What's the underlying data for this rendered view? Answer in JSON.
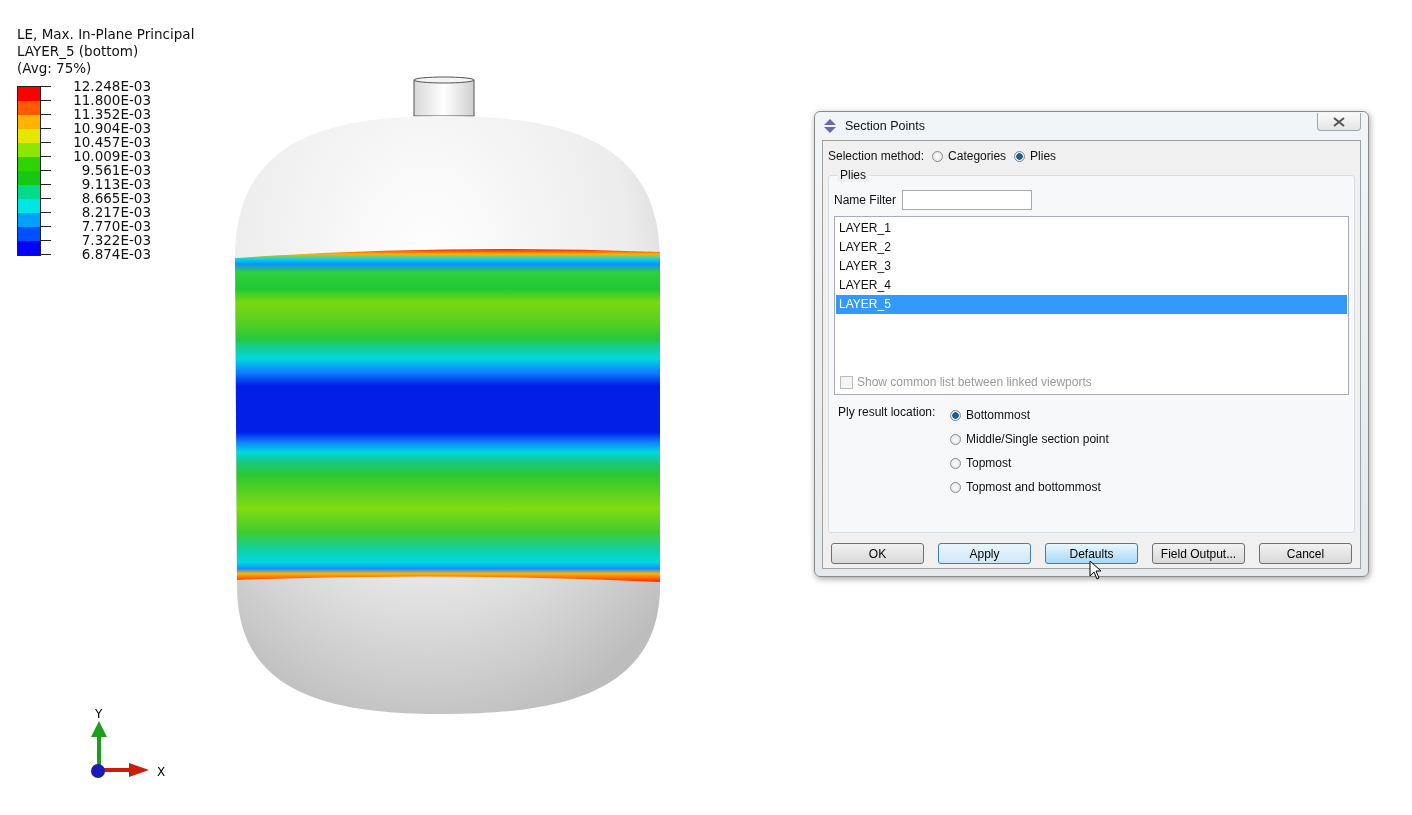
{
  "legend": {
    "title_lines": [
      "LE, Max. In-Plane Principal",
      "LAYER_5 (bottom)",
      "(Avg: 75%)"
    ],
    "bands": [
      {
        "color": "#ff0000"
      },
      {
        "color": "#ff5a00"
      },
      {
        "color": "#ffb400"
      },
      {
        "color": "#e6e600"
      },
      {
        "color": "#8ce600"
      },
      {
        "color": "#2ed400"
      },
      {
        "color": "#14c814"
      },
      {
        "color": "#00dc8c"
      },
      {
        "color": "#00e6e6"
      },
      {
        "color": "#00a0ff"
      },
      {
        "color": "#0050ff"
      },
      {
        "color": "#0000ff"
      }
    ],
    "ticks": [
      "12.248E-03",
      "11.800E-03",
      "11.352E-03",
      "10.904E-03",
      "10.457E-03",
      "10.009E-03",
      "9.561E-03",
      "9.113E-03",
      "8.665E-03",
      "8.217E-03",
      "7.770E-03",
      "7.322E-03",
      "6.874E-03"
    ]
  },
  "axes": {
    "y_label": "Y",
    "x_label": "X"
  },
  "dialog": {
    "title": "Section Points",
    "selection_method": {
      "label": "Selection method:",
      "options": [
        {
          "label": "Categories",
          "selected": false
        },
        {
          "label": "Plies",
          "selected": true
        }
      ]
    },
    "plies_group": {
      "title": "Plies",
      "name_filter_label": "Name Filter",
      "items": [
        {
          "label": "LAYER_1",
          "selected": false
        },
        {
          "label": "LAYER_2",
          "selected": false
        },
        {
          "label": "LAYER_3",
          "selected": false
        },
        {
          "label": "LAYER_4",
          "selected": false
        },
        {
          "label": "LAYER_5",
          "selected": true
        }
      ],
      "show_common": {
        "label": "Show common list between linked viewports",
        "checked": false,
        "disabled": true
      }
    },
    "ply_result_location": {
      "label": "Ply result location:",
      "options": [
        {
          "label": "Bottommost",
          "selected": true
        },
        {
          "label": "Middle/Single section point",
          "selected": false
        },
        {
          "label": "Topmost",
          "selected": false
        },
        {
          "label": "Topmost and bottommost",
          "selected": false
        }
      ]
    },
    "buttons": [
      {
        "label": "OK",
        "focused": false,
        "hovered": false
      },
      {
        "label": "Apply",
        "focused": true,
        "hovered": false
      },
      {
        "label": "Defaults",
        "focused": false,
        "hovered": true
      },
      {
        "label": "Field Output...",
        "focused": false,
        "hovered": false
      },
      {
        "label": "Cancel",
        "focused": false,
        "hovered": false
      }
    ]
  }
}
